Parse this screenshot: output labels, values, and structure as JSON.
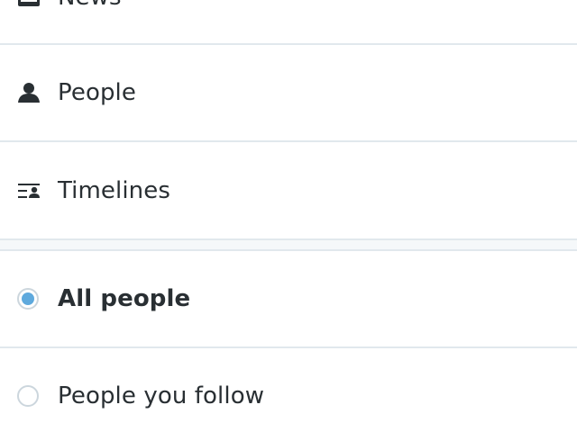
{
  "menu": {
    "items": [
      {
        "label": "News",
        "icon": "newspaper-icon"
      },
      {
        "label": "People",
        "icon": "person-icon"
      },
      {
        "label": "Timelines",
        "icon": "timelines-icon"
      }
    ]
  },
  "filter": {
    "options": [
      {
        "label": "All people",
        "selected": true
      },
      {
        "label": "People you follow",
        "selected": false
      }
    ]
  },
  "colors": {
    "text": "#292f33",
    "divider": "#e1e8ed",
    "section_gap": "#f5f8fa",
    "radio_selected": "#5ea9dd",
    "radio_border": "#ccd6dd"
  }
}
